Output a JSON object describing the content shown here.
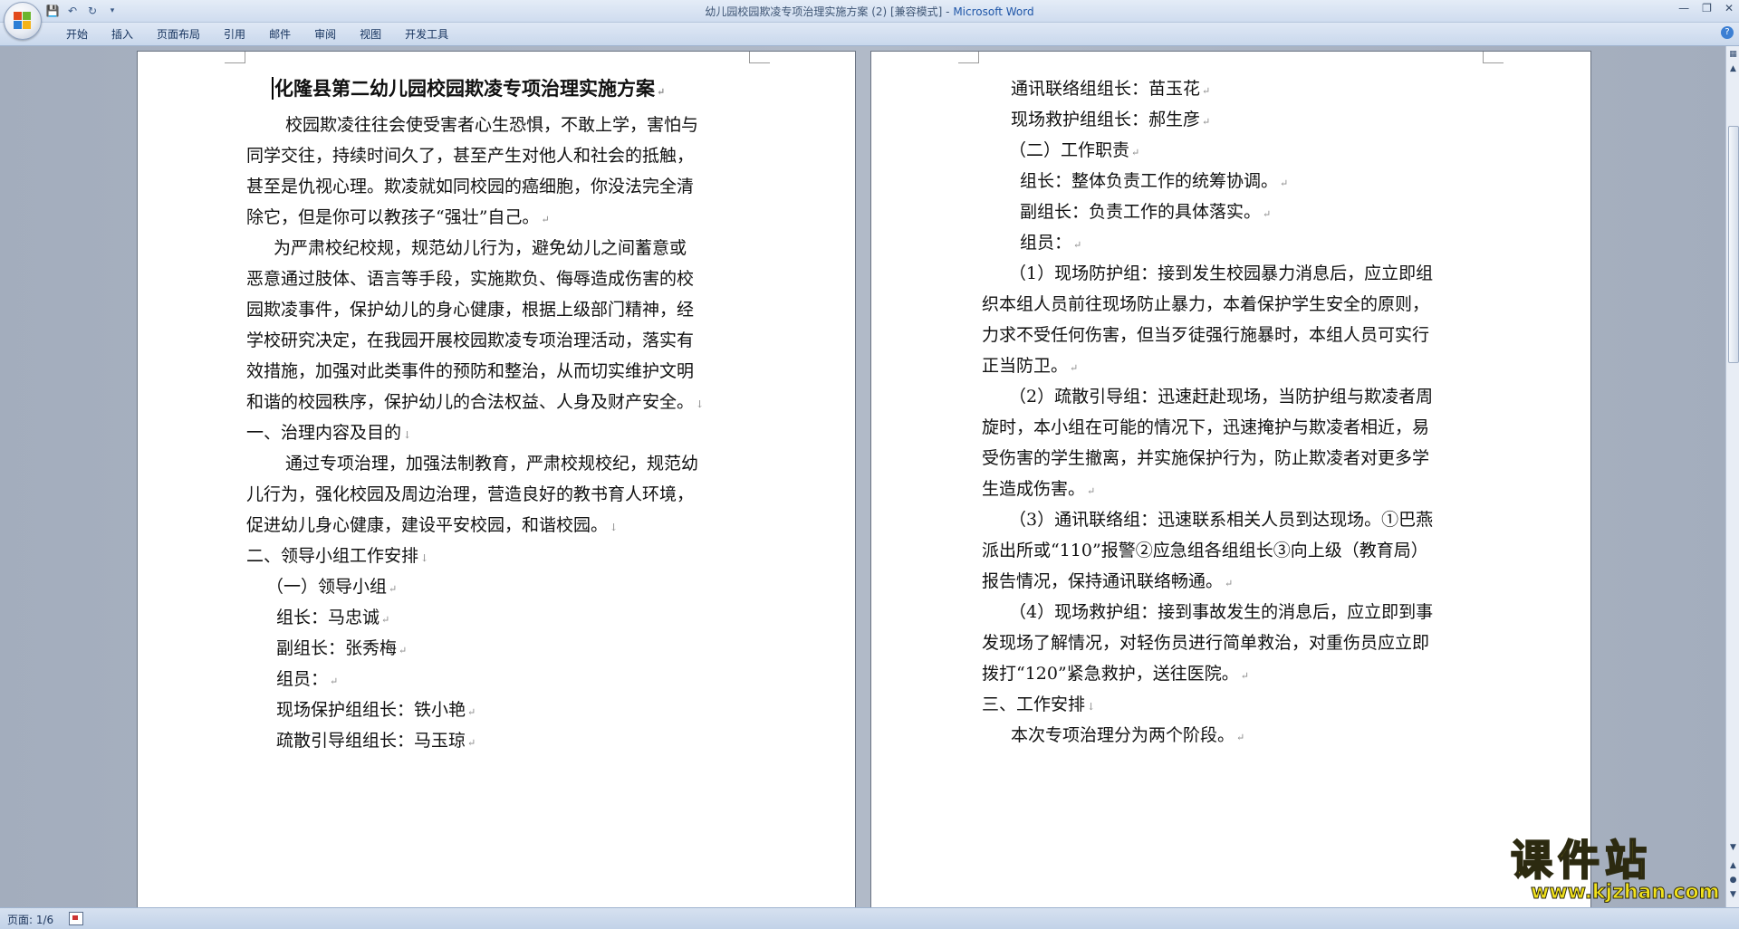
{
  "window": {
    "doc_name": "幼儿园校园欺凌专项治理实施方案 (2) [兼容模式] - ",
    "app_name": "Microsoft Word"
  },
  "ribbon": {
    "tabs": [
      "开始",
      "插入",
      "页面布局",
      "引用",
      "邮件",
      "审阅",
      "视图",
      "开发工具"
    ]
  },
  "status": {
    "page": "页面: 1/6"
  },
  "page1": {
    "title": "化隆县第二幼儿园校园欺凌专项治理实施方案",
    "lines": [
      "校园欺凌往往会使受害者心生恐惧，不敢上学，害怕与",
      "同学交往，持续时间久了，甚至产生对他人和社会的抵触，",
      "甚至是仇视心理。欺凌就如同校园的癌细胞，你没法完全清",
      "除它，但是你可以教孩子“强壮”自己。",
      "为严肃校纪校规，规范幼儿行为，避免幼儿之间蓄意或",
      "恶意通过肢体、语言等手段，实施欺负、侮辱造成伤害的校",
      "园欺凌事件，保护幼儿的身心健康，根据上级部门精神，经",
      "学校研究决定，在我园开展校园欺凌专项治理活动，落实有",
      "效措施，加强对此类事件的预防和整治，从而切实维护文明",
      "和谐的校园秩序，保护幼儿的合法权益、人身及财产安全。",
      "一、治理内容及目的",
      "通过专项治理，加强法制教育，严肃校规校纪，规范幼",
      "儿行为，强化校园及周边治理，营造良好的教书育人环境，",
      "促进幼儿身心健康，建设平安校园，和谐校园。",
      "二、领导小组工作安排",
      "（一）领导小组",
      "组长：马忠诚",
      "副组长：张秀梅",
      "组员：",
      "现场保护组组长：铁小艳",
      "疏散引导组组长：马玉琼"
    ]
  },
  "page2": {
    "lines": [
      "通讯联络组组长：苗玉花",
      "现场救护组组长：郝生彦",
      "（二）工作职责",
      "组长：整体负责工作的统筹协调。",
      "副组长：负责工作的具体落实。",
      "组员：",
      "（1）现场防护组：接到发生校园暴力消息后，应立即组",
      "织本组人员前往现场防止暴力，本着保护学生安全的原则，",
      "力求不受任何伤害，但当歹徒强行施暴时，本组人员可实行",
      "正当防卫。",
      "（2）疏散引导组：迅速赶赴现场，当防护组与欺凌者周",
      "旋时，本小组在可能的情况下，迅速掩护与欺凌者相近，易",
      "受伤害的学生撤离，并实施保护行为，防止欺凌者对更多学",
      "生造成伤害。",
      "（3）通讯联络组：迅速联系相关人员到达现场。①巴燕",
      "派出所或“110”报警②应急组各组组长③向上级（教育局）",
      "报告情况，保持通讯联络畅通。",
      "（4）现场救护组：接到事故发生的消息后，应立即到事",
      "发现场了解情况，对轻伤员进行简单救治，对重伤员应立即",
      "拨打“120”紧急救护，送往医院。",
      "三、工作安排",
      "本次专项治理分为两个阶段。"
    ]
  },
  "watermark": {
    "cn": "课件站",
    "url": "www.kjzhan.com"
  }
}
